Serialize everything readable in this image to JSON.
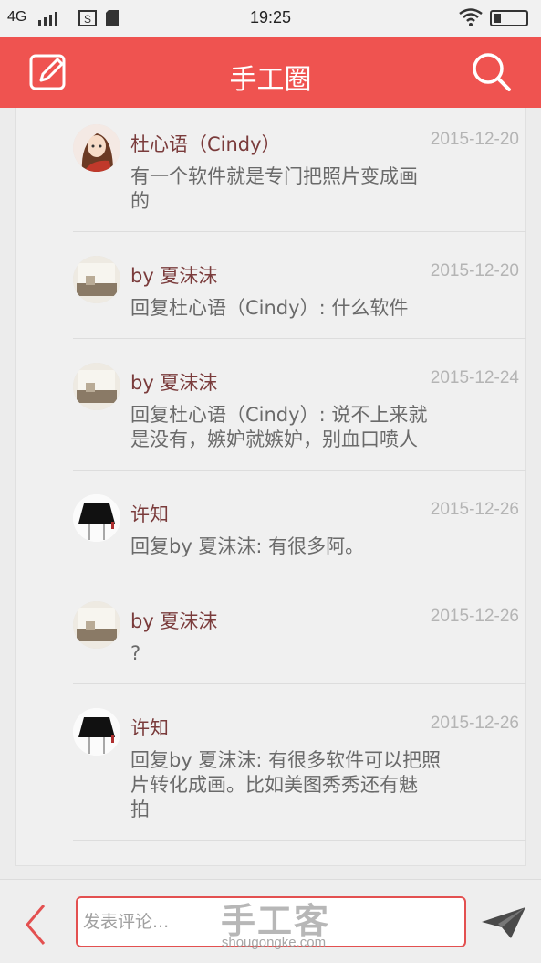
{
  "status_bar": {
    "network": "4G",
    "time": "19:25"
  },
  "header": {
    "title": "手工圈",
    "edit_icon": "edit-icon",
    "search_icon": "search-icon",
    "color": "#ef5350"
  },
  "comments": [
    {
      "name": "杜心语（Cindy）",
      "date": "2015-12-20",
      "lines": [
        "有一个软件就是专门把照片变成画",
        "的"
      ]
    },
    {
      "name": "by 夏沫沫",
      "date": "2015-12-20",
      "lines": [
        "回复杜心语（Cindy）: 什么软件"
      ]
    },
    {
      "name": "by 夏沫沫",
      "date": "2015-12-24",
      "lines": [
        "回复杜心语（Cindy）: 说不上来就",
        "是没有，嫉妒就嫉妒，别血口喷人"
      ]
    },
    {
      "name": "许知",
      "date": "2015-12-26",
      "lines": [
        "回复by 夏沫沫: 有很多阿。"
      ]
    },
    {
      "name": "by 夏沫沫",
      "date": "2015-12-26",
      "lines": [
        "?"
      ]
    },
    {
      "name": "许知",
      "date": "2015-12-26",
      "lines": [
        "回复by 夏沫沫: 有很多软件可以把照",
        "片转化成画。比如美图秀秀还有魅",
        "拍"
      ]
    }
  ],
  "bottom_bar": {
    "input_placeholder": "发表评论...",
    "back_icon": "back-arrow-icon",
    "send_icon": "send-icon",
    "watermark": "手工客",
    "watermark_url": "shougongke.com"
  }
}
